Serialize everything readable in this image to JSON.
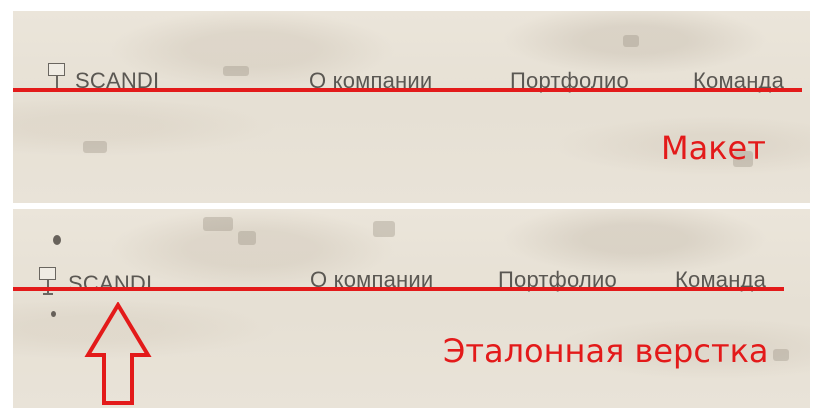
{
  "mockup": {
    "logo_text": "SCANDI",
    "nav": [
      "О компании",
      "Портфолио",
      "Команда"
    ],
    "caption": "Макет"
  },
  "reference": {
    "logo_text": "SCANDI",
    "nav": [
      "О компании",
      "Портфолио",
      "Команда"
    ],
    "caption": "Эталонная верстка"
  },
  "colors": {
    "annotation_red": "#e31a1a",
    "text_gray": "#5a5752"
  },
  "icons": {
    "logo": "monitor-on-stand-icon",
    "pointer": "up-arrow-outline-icon"
  }
}
